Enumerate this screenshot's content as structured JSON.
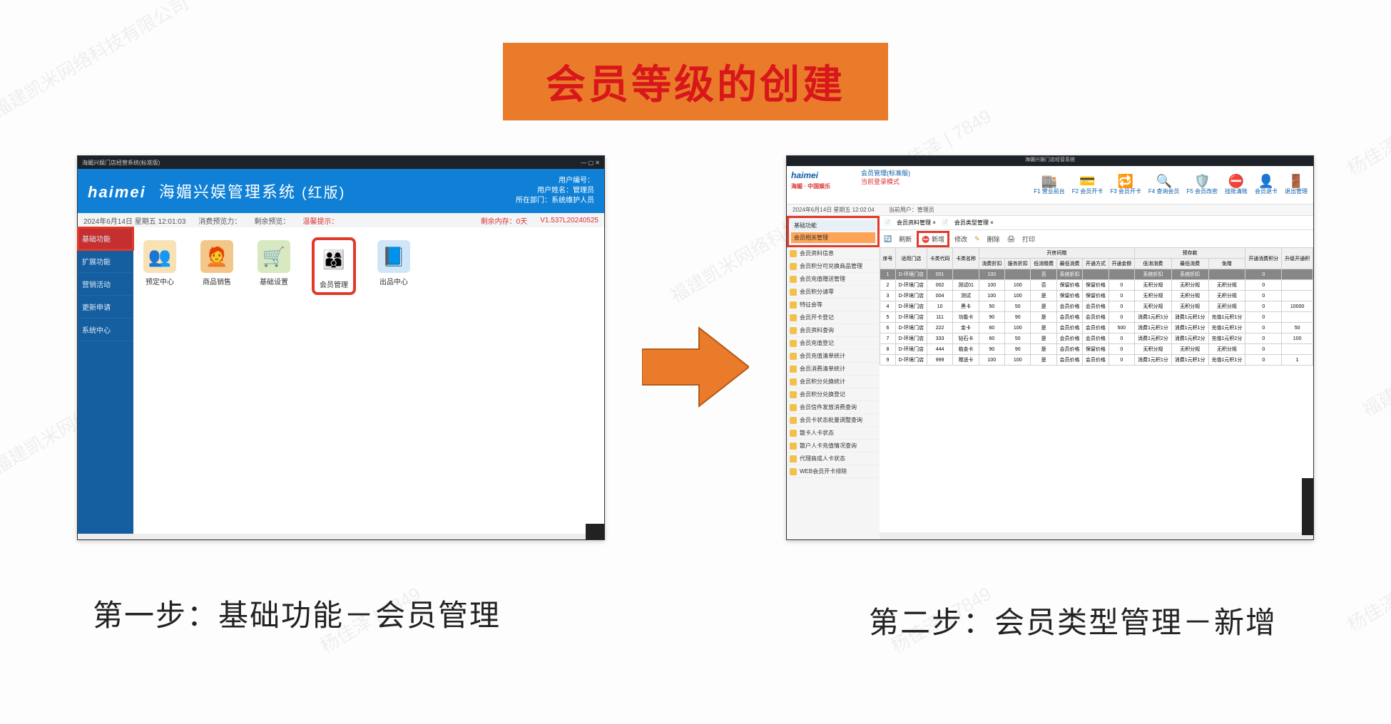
{
  "title": "会员等级的创建",
  "watermarks": [
    "杨佳泽 | 7849",
    "福建凯米网络科技有限公司"
  ],
  "captions": {
    "left": "第一步：基础功能－会员管理",
    "right": "第二步：会员类型管理－新增"
  },
  "shot_left": {
    "window_title": "海媚兴娱门店经营系统(标准版)",
    "brand_logo": "haimei",
    "brand_text": "海媚兴娱管理系统",
    "brand_ver": "(红版)",
    "info_lines": [
      "用户编号：",
      "用户姓名：管理员",
      "所在部门：系统维护人员"
    ],
    "status": {
      "date": "2024年6月14日 星期五 12:01:03",
      "n1": "消费预览力：",
      "n2": "剩余预览：",
      "n3_red": "温馨提示：",
      "mem": "剩余内存：0天",
      "ver": "V1.537L20240525"
    },
    "side_items": [
      "基础功能",
      "扩展功能",
      "营销活动",
      "更新申请",
      "系统中心"
    ],
    "icons": [
      {
        "label": "预定中心",
        "emoji": "👥",
        "bg": "#f7e1b5"
      },
      {
        "label": "商品销售",
        "emoji": "🧑‍🦰",
        "bg": "#f3c78a"
      },
      {
        "label": "基础设置",
        "emoji": "🛒",
        "bg": "#d8e8c0"
      },
      {
        "label": "会员管理",
        "emoji": "👨‍👩‍👦",
        "bg": "#fff"
      },
      {
        "label": "出品中心",
        "emoji": "📘",
        "bg": "#d0e6f7"
      }
    ]
  },
  "shot_right": {
    "window_title": "海媚兴娱门店经营系统",
    "brand_logo": "haimei",
    "brand_sub": "海媚 · 中国娱乐",
    "crumb1": "会员管理(标准版)",
    "crumb2": "当前登录模式",
    "status": {
      "date": "2024年6月14日 星期五 12:02:04",
      "user": "当前用户：管理员"
    },
    "toolbar": [
      {
        "ic": "🏬",
        "t": "F1 营业前台"
      },
      {
        "ic": "💳",
        "t": "F2 会员开卡"
      },
      {
        "ic": "🔁",
        "t": "F3 会员开卡"
      },
      {
        "ic": "🔍",
        "t": "F4 查询会员"
      },
      {
        "ic": "🛡️",
        "t": "F5 会员改密"
      },
      {
        "ic": "⛔",
        "t": "挂账清账"
      },
      {
        "ic": "👤",
        "t": "会员退卡"
      },
      {
        "ic": "🚪",
        "t": "退出管理"
      }
    ],
    "side_top": {
      "a": "基础功能",
      "b": "会员相关管理"
    },
    "side_items": [
      "会员资料信息",
      "会员积分可兑换商品管理",
      "会员充值赠送管理",
      "会员积分请零",
      "特征会等",
      "会员开卡登记",
      "会员资料查询",
      "会员充值登记",
      "会员充值清单统计",
      "会员消费清单统计",
      "会员积分兑换统计",
      "会员积分兑换登记",
      "会员信件发放消费查询",
      "会员卡状态批量调整查询",
      "散卡人卡状态",
      "散户人卡充值情况查询",
      "代理商成人卡状态",
      "WEB会员开卡排除"
    ],
    "tabs": [
      "会员资料管理 ×",
      "会员类型管理 ×"
    ],
    "tools": {
      "refresh": "刷新",
      "new": "新增",
      "edit": "修改",
      "del": "删除",
      "export": "打印"
    },
    "header_groups": [
      "开房间赠",
      "预存款"
    ],
    "headers": [
      "序号",
      "适用门店",
      "卡类代码",
      "卡类名称",
      "消费折扣",
      "服务折扣",
      "低消赠费",
      "最低消费",
      "开通方式",
      "开通金额",
      "低消消费",
      "最低消费",
      "免赠",
      "开通消费积分",
      "升级开通积"
    ],
    "rows": [
      {
        "sel": true,
        "c": [
          "1",
          "D-环境门店",
          "001",
          "",
          "100",
          "",
          "否",
          "系统折扣",
          "",
          "",
          "系统折扣",
          "系统折扣",
          "",
          "0",
          ""
        ]
      },
      {
        "c": [
          "2",
          "D-环境门店",
          "002",
          "测试01",
          "100",
          "100",
          "否",
          "保留价格",
          "保留价格",
          "0",
          "无积分规",
          "无积分规",
          "无积分规",
          "0",
          ""
        ]
      },
      {
        "c": [
          "3",
          "D-环境门店",
          "004",
          "测试",
          "100",
          "100",
          "是",
          "保留价格",
          "保留价格",
          "0",
          "无积分规",
          "无积分规",
          "无积分规",
          "0",
          ""
        ]
      },
      {
        "c": [
          "4",
          "D-环境门店",
          "10",
          "黑卡",
          "50",
          "50",
          "是",
          "会员价格",
          "会员价格",
          "0",
          "无积分规",
          "无积分规",
          "无积分规",
          "0",
          "10000"
        ]
      },
      {
        "c": [
          "5",
          "D-环境门店",
          "111",
          "功能卡",
          "90",
          "90",
          "是",
          "会员价格",
          "会员价格",
          "0",
          "消费1元积1分",
          "消费1元积1分",
          "充值1元积1分",
          "0",
          ""
        ]
      },
      {
        "c": [
          "6",
          "D-环境门店",
          "222",
          "金卡",
          "60",
          "100",
          "是",
          "会员价格",
          "会员价格",
          "500",
          "消费1元积1分",
          "消费1元积1分",
          "充值1元积1分",
          "0",
          "50"
        ]
      },
      {
        "c": [
          "7",
          "D-环境门店",
          "333",
          "钻石卡",
          "60",
          "50",
          "是",
          "会员价格",
          "会员价格",
          "0",
          "消费1元积2分",
          "消费1元积2分",
          "充值1元积2分",
          "0",
          "100"
        ]
      },
      {
        "c": [
          "8",
          "D-环境门店",
          "444",
          "临金卡",
          "90",
          "90",
          "是",
          "会员价格",
          "保留价格",
          "0",
          "无积分规",
          "无积分规",
          "无积分规",
          "0",
          ""
        ]
      },
      {
        "c": [
          "9",
          "D-环境门店",
          "999",
          "赠送卡",
          "100",
          "100",
          "是",
          "会员价格",
          "会员价格",
          "0",
          "消费1元积1分",
          "消费1元积1分",
          "充值1元积1分",
          "0",
          "1"
        ]
      }
    ]
  }
}
